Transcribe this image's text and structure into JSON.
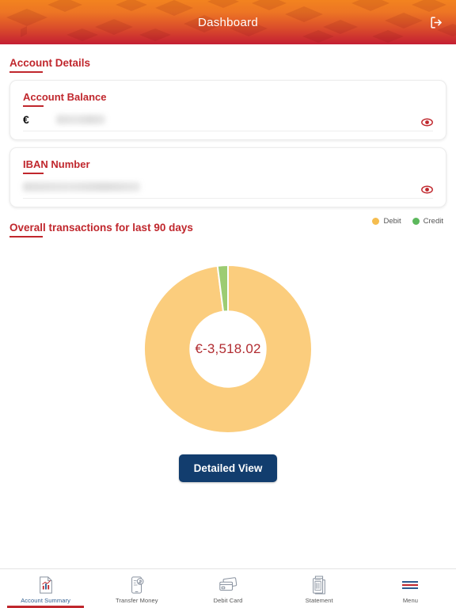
{
  "header": {
    "title": "Dashboard",
    "logout_icon": "logout-icon",
    "gradient_from": "#f2831f",
    "gradient_to": "#c41f33"
  },
  "account_details": {
    "section_title": "Account Details",
    "balance_card": {
      "label": "Account Balance",
      "currency_symbol": "€",
      "value_masked": true,
      "eye_icon": "eye-icon"
    },
    "iban_card": {
      "label": "IBAN Number",
      "value_masked": true,
      "eye_icon": "eye-icon"
    }
  },
  "transactions": {
    "section_title": "Overall transactions for last 90 days",
    "detailed_view_label": "Detailed View",
    "center_value": "€-3,518.02"
  },
  "chart_data": {
    "type": "pie",
    "title": "Overall transactions for last 90 days",
    "subtitle": "",
    "categories": [
      "Debit",
      "Credit"
    ],
    "values": [
      98,
      2
    ],
    "colors": [
      "#fbcd7d",
      "#9ccc72"
    ],
    "center_label": "€-3,518.02",
    "center_label_color": "#b12c31",
    "legend": [
      {
        "label": "Debit",
        "color": "#f5bd4f"
      },
      {
        "label": "Credit",
        "color": "#5cb85c"
      }
    ],
    "legend_position": "top-right",
    "donut": true,
    "inner_radius_ratio": 0.45,
    "start_angle_deg": -90,
    "grid": false
  },
  "bottom_nav": {
    "items": [
      {
        "label": "Account Summary",
        "icon": "account-summary-icon",
        "active": true
      },
      {
        "label": "Transfer Money",
        "icon": "transfer-money-icon",
        "active": false
      },
      {
        "label": "Debit Card",
        "icon": "debit-card-icon",
        "active": false
      },
      {
        "label": "Statement",
        "icon": "statement-icon",
        "active": false
      },
      {
        "label": "Menu",
        "icon": "hamburger-menu-icon",
        "active": false
      }
    ],
    "active_color": "#c0272d"
  }
}
